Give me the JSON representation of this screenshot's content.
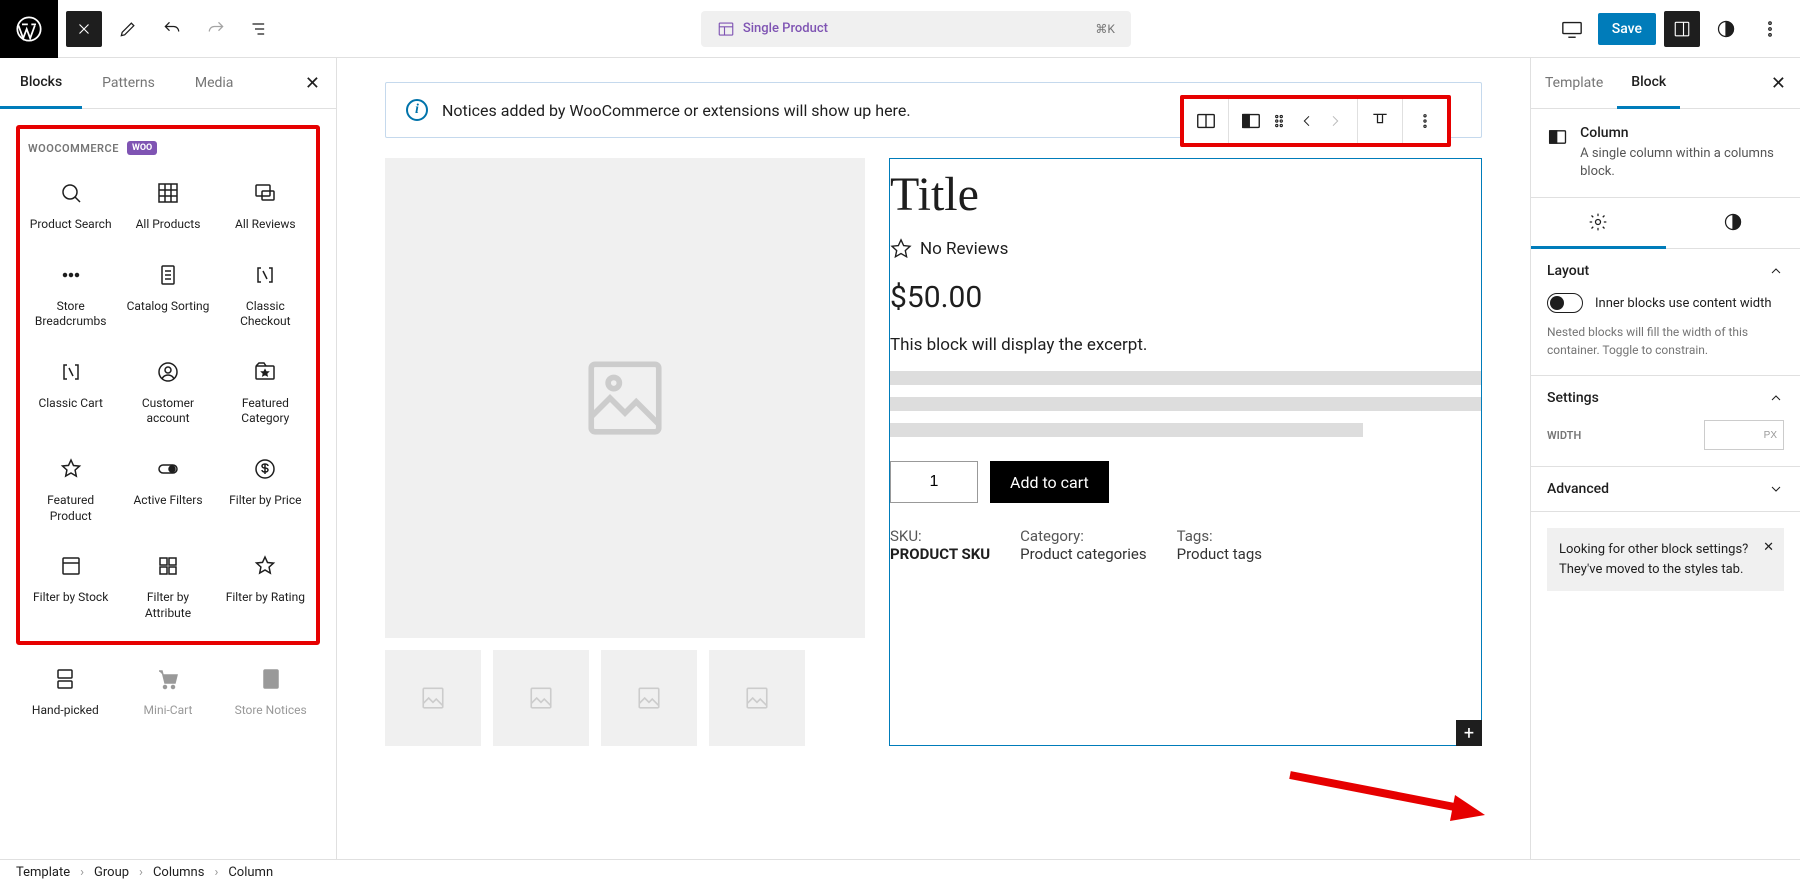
{
  "topbar": {
    "title": "Single Product",
    "shortcut": "⌘K",
    "save": "Save"
  },
  "left_panel": {
    "tabs": [
      "Blocks",
      "Patterns",
      "Media"
    ],
    "active_tab": 0,
    "category": "WOOCOMMERCE",
    "badge": "WOO",
    "blocks": [
      {
        "label": "Product Search",
        "icon": "search-icon"
      },
      {
        "label": "All Products",
        "icon": "grid-icon"
      },
      {
        "label": "All Reviews",
        "icon": "chat-icon"
      },
      {
        "label": "Store Breadcrumbs",
        "icon": "dots-icon"
      },
      {
        "label": "Catalog Sorting",
        "icon": "list-icon"
      },
      {
        "label": "Classic Checkout",
        "icon": "brackets-icon"
      },
      {
        "label": "Classic Cart",
        "icon": "brackets-icon"
      },
      {
        "label": "Customer account",
        "icon": "user-icon"
      },
      {
        "label": "Featured Category",
        "icon": "folder-star-icon"
      },
      {
        "label": "Featured Product",
        "icon": "star-icon"
      },
      {
        "label": "Active Filters",
        "icon": "toggle-icon"
      },
      {
        "label": "Filter by Price",
        "icon": "dollar-icon"
      },
      {
        "label": "Filter by Stock",
        "icon": "box-icon"
      },
      {
        "label": "Filter by Attribute",
        "icon": "grid4-icon"
      },
      {
        "label": "Filter by Rating",
        "icon": "star-icon"
      }
    ],
    "extra_blocks": [
      {
        "label": "Hand-picked",
        "icon": "handpick-icon",
        "muted": false
      },
      {
        "label": "Mini-Cart",
        "icon": "cart-icon",
        "muted": true
      },
      {
        "label": "Store Notices",
        "icon": "notice-icon",
        "muted": true
      }
    ]
  },
  "canvas": {
    "notice": "Notices added by WooCommerce or extensions will show up here.",
    "product": {
      "title": "Title",
      "reviews": "No Reviews",
      "price": "$50.00",
      "excerpt": "This block will display the excerpt.",
      "qty": "1",
      "add_to_cart": "Add to cart",
      "meta": [
        {
          "label": "SKU:",
          "value": "PRODUCT SKU"
        },
        {
          "label": "Category:",
          "value": "Product categories"
        },
        {
          "label": "Tags:",
          "value": "Product tags"
        }
      ]
    }
  },
  "right_panel": {
    "tabs": [
      "Template",
      "Block"
    ],
    "active_tab": 1,
    "block_name": "Column",
    "block_desc": "A single column within a columns block.",
    "sections": {
      "layout": {
        "title": "Layout",
        "toggle_label": "Inner blocks use content width",
        "help": "Nested blocks will fill the width of this container. Toggle to constrain."
      },
      "settings": {
        "title": "Settings",
        "width_label": "WIDTH",
        "width_unit": "PX"
      },
      "advanced": {
        "title": "Advanced"
      }
    },
    "tip": "Looking for other block settings? They've moved to the styles tab."
  },
  "breadcrumb": [
    "Template",
    "Group",
    "Columns",
    "Column"
  ]
}
